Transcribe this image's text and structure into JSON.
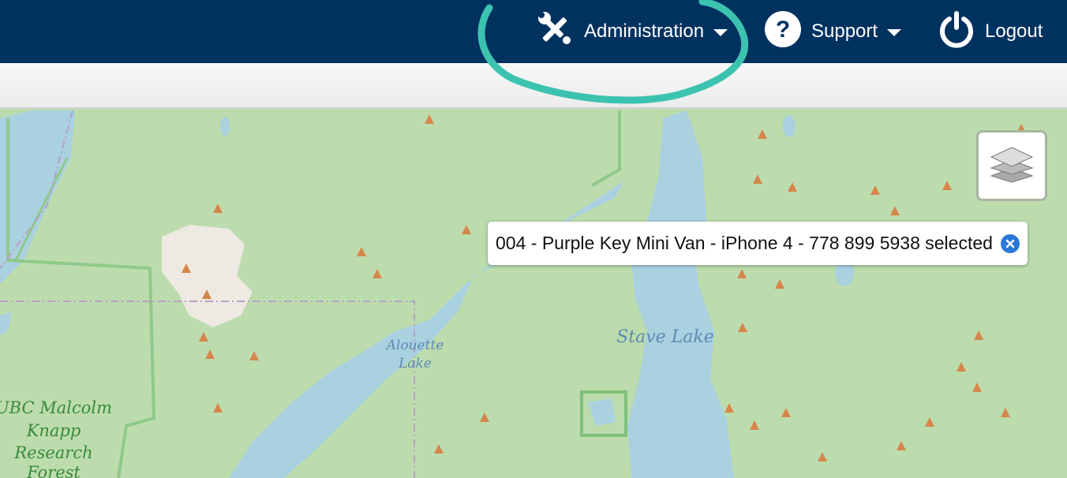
{
  "nav": {
    "administration_label": "Administration",
    "support_label": "Support",
    "logout_label": "Logout"
  },
  "icons": {
    "administration": "wrench-screwdriver-icon",
    "support": "question-circle-icon",
    "logout": "power-icon",
    "layers": "layers-icon",
    "close": "close-icon"
  },
  "map": {
    "tooltip_text": "004 - Purple Key Mini Van - iPhone 4 - 778 899 5938 selected",
    "labels": {
      "stave_lake": "Stave Lake",
      "alouette_line1": "Alouette",
      "alouette_line2": "Lake",
      "forest_line1": "UBC Malcolm",
      "forest_line2": "Knapp",
      "forest_line3": "Research",
      "forest_line4": "Forest"
    }
  },
  "colors": {
    "header_bg": "#003260",
    "land": "#bcdcae",
    "water": "#a9d1e0",
    "park_border": "#7fc07a",
    "peak": "#d6864b",
    "annotation": "#3cc3b0",
    "close_button": "#2979d6"
  }
}
